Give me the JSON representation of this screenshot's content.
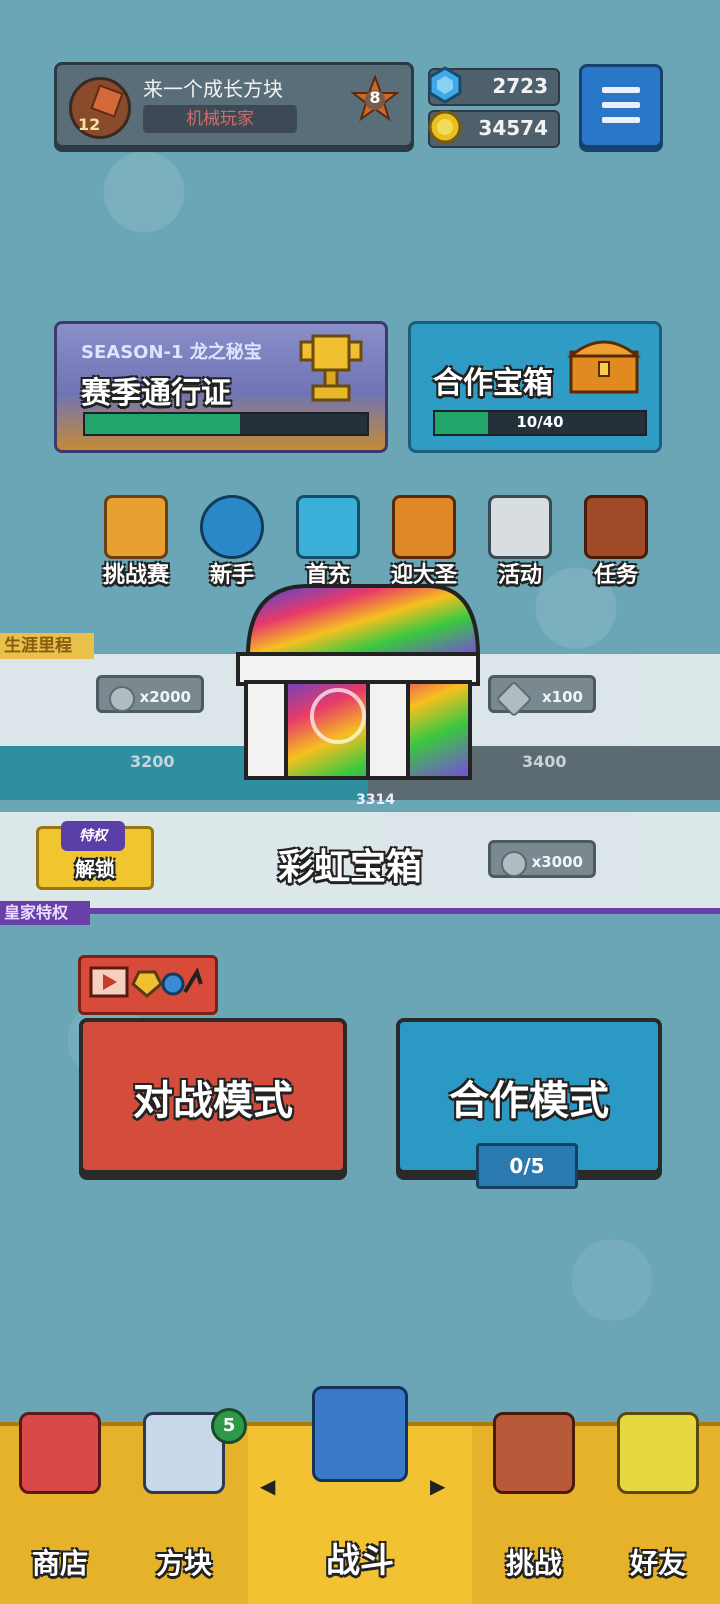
{
  "profile": {
    "level": "12",
    "name": "来一个成长方块",
    "title": "机械玩家",
    "rank": "8"
  },
  "currencies": {
    "gems": "2723",
    "coins": "34574"
  },
  "season": {
    "season_label": "SEASON-1 龙之秘宝",
    "pass_label": "赛季通行证",
    "progress": 0.55
  },
  "coop_chest": {
    "label": "合作宝箱",
    "progress_text": "10/40",
    "progress": 0.25
  },
  "icons": [
    "挑战赛",
    "新手",
    "首充",
    "迎大圣",
    "活动",
    "任务"
  ],
  "career": {
    "tag": "生涯里程",
    "rewards": [
      "x2000",
      "x100"
    ],
    "ticks": [
      "3200",
      "3400"
    ],
    "current_score": "3314",
    "royal_tag": "皇家特权",
    "unlock_badge": "特权",
    "unlock_label": "解锁",
    "royal_reward": "x3000"
  },
  "popup": {
    "chest_name": "彩虹宝箱"
  },
  "modes": {
    "battle": "对战模式",
    "coop": "合作模式",
    "coop_count": "0/5"
  },
  "nav": {
    "shop": "商店",
    "blocks": "方块",
    "blocks_badge": "5",
    "battle": "战斗",
    "challenge": "挑战",
    "friends": "好友"
  },
  "colors": {
    "background": "#6ba6b6",
    "battle_button": "#d44c3c",
    "coop_button": "#2a9ac4",
    "nav_bar": "#e6b22a",
    "royal": "#6a3fa8"
  }
}
